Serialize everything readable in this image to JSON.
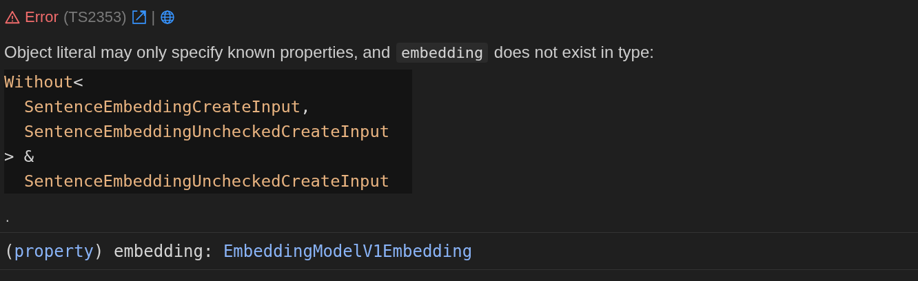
{
  "header": {
    "severity": {
      "kind": "error",
      "label": "Error"
    },
    "code": "(TS2353)",
    "separator": "|"
  },
  "message": [
    {
      "kind": "text",
      "text": "Object literal may only specify known properties, and "
    },
    {
      "kind": "code",
      "text": "embedding"
    },
    {
      "kind": "text",
      "text": " does not exist in type:"
    }
  ],
  "code_block": [
    {
      "indent": false,
      "tokens": [
        {
          "kind": "type",
          "text": "Without"
        },
        {
          "kind": "punct",
          "text": "<"
        }
      ]
    },
    {
      "indent": true,
      "tokens": [
        {
          "kind": "type",
          "text": "SentenceEmbeddingCreateInput"
        },
        {
          "kind": "punct",
          "text": ","
        }
      ]
    },
    {
      "indent": true,
      "tokens": [
        {
          "kind": "type",
          "text": "SentenceEmbeddingUncheckedCreateInput"
        }
      ]
    },
    {
      "indent": false,
      "tokens": [
        {
          "kind": "punct",
          "text": "> &"
        }
      ]
    },
    {
      "indent": true,
      "tokens": [
        {
          "kind": "type",
          "text": "SentenceEmbeddingUncheckedCreateInput"
        }
      ]
    }
  ],
  "trailer": ".",
  "signature": [
    {
      "kind": "punct",
      "text": "("
    },
    {
      "kind": "keyword",
      "text": "property"
    },
    {
      "kind": "punct",
      "text": ") embedding: "
    },
    {
      "kind": "keyword",
      "text": "EmbeddingModelV1Embedding"
    }
  ]
}
